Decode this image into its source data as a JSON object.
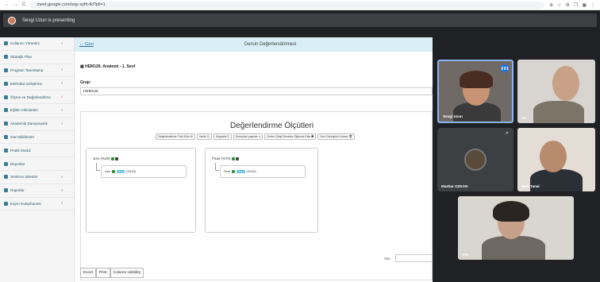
{
  "browser": {
    "url": "meet.google.com/sqy-syfh-fki?pli=1",
    "nav": [
      "←",
      "→",
      "C"
    ],
    "ext": [
      "⊕",
      "☆",
      "⚙",
      "❐",
      "▣",
      "⋮"
    ]
  },
  "presenting": "Sevgi Uzun is presenting",
  "sidebar": {
    "items": [
      {
        "label": "Kullanıcı Yönetimi",
        "chev": "‹"
      },
      {
        "label": "Stratejik Plan",
        "chev": ""
      },
      {
        "label": "Program Tanımlama",
        "chev": "‹"
      },
      {
        "label": "Müfredat Geliştirme",
        "chev": "‹"
      },
      {
        "label": "Ölçme ve Değerlendirme",
        "chev": "‹"
      },
      {
        "label": "Eğitim Aktiviteleri",
        "chev": "‹"
      },
      {
        "label": "Akademik Danışmanlık",
        "chev": "‹"
      },
      {
        "label": "Geri Bildirimler",
        "chev": ""
      },
      {
        "label": "Pratik Modul",
        "chev": ""
      },
      {
        "label": "Deyonlar",
        "chev": ""
      },
      {
        "label": "Senkron İşlemler",
        "chev": "‹"
      },
      {
        "label": "Raporlar",
        "chev": "‹"
      },
      {
        "label": "Kayıtı Kütüphanesi",
        "chev": "‹"
      }
    ]
  },
  "topbar": {
    "back": "← Geri",
    "title": "Dersin Değerlendirilmesi"
  },
  "course": "▣ HEM126: Anatomi - 1. Sınıf",
  "group": {
    "label": "Grup:",
    "value": "HEM125"
  },
  "panel": {
    "title": "Değerlendirme Ölçütleri",
    "tools": [
      "Değerlendirme Türü Ekle ⊞",
      "Verile ⊡",
      "Kopyala ⎘",
      "Sonuçları yayınla ⋖",
      "Derse Girişi Deneten Öğrenci Ekle ⯃",
      "Geri Dönüşüm Kutusu 🗑"
    ],
    "boxes": [
      {
        "label": "vize (%30)",
        "sub": "vize",
        "badge": "Yayım",
        "pct": "(%100)"
      },
      {
        "label": "Final (%70)",
        "sub": "Final",
        "badge": "Yayım",
        "pct": "(%100)"
      }
    ]
  },
  "search_label": "Ara:",
  "buttons": [
    "Excel",
    "Print",
    "Column visibility"
  ],
  "participants": [
    {
      "name": "Sevgi Uzun",
      "mic": "❚❚❚"
    },
    {
      "name": "Ali",
      "mic": ""
    },
    {
      "name": "Mazhar OZKAN",
      "mic": "🎤"
    },
    {
      "name": "Mert Tanal",
      "mic": ""
    },
    {
      "name": "You",
      "mic": ""
    }
  ],
  "colors": {
    "accent": "#2a6fa0",
    "meet_bg": "#202124",
    "active_speaker": "#8ab4f8"
  }
}
